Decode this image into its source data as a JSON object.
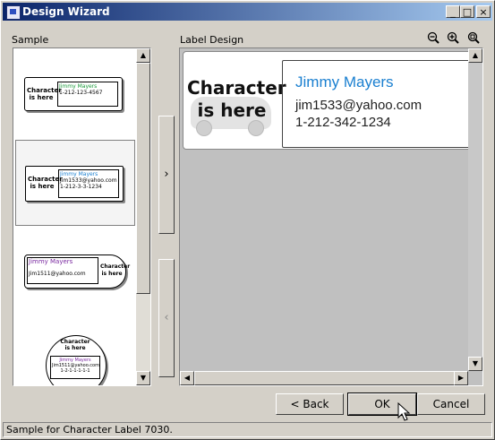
{
  "window": {
    "title": "Design Wizard"
  },
  "titlebar_buttons": {
    "minimize": "_",
    "maximize": "□",
    "close": "×"
  },
  "panels": {
    "sample_label": "Sample",
    "design_label": "Label Design"
  },
  "zoom_icons": [
    "zoom-out-icon",
    "zoom-in-icon",
    "zoom-fit-icon"
  ],
  "samples": [
    {
      "char": "Character is here",
      "name": "Jimmy Mayers",
      "email": "",
      "phone": "1-212-123-4567",
      "name_color": "#1a9a3a"
    },
    {
      "char": "Character is here",
      "name": "Jimmy Mayers",
      "email": "Jim1533@yahoo.com",
      "phone": "1-212-3-3-1234",
      "name_color": "#1a7fd0"
    },
    {
      "char": "Character is here",
      "name": "Jimmy Mayers",
      "email": "Jim1511@yahoo.com",
      "phone": "",
      "name_color": "#7a2aa0"
    },
    {
      "char": "Character is here",
      "name": "Jimmy Mayers",
      "email": "Jim1511@yahoo.com",
      "phone": "1-2-1-1-1-1-1",
      "name_color": "#7a2aa0"
    }
  ],
  "arrows": {
    "add": "›",
    "remove": "‹"
  },
  "label_design": {
    "character_text": "Character is here",
    "name": "Jimmy Mayers",
    "email": "jim1533@yahoo.com",
    "phone": "1-212-342-1234",
    "name_color": "#1a7fd0"
  },
  "buttons": {
    "back": "< Back",
    "ok": "OK",
    "cancel": "Cancel"
  },
  "status": {
    "text": "Sample for Character Label 7030."
  }
}
